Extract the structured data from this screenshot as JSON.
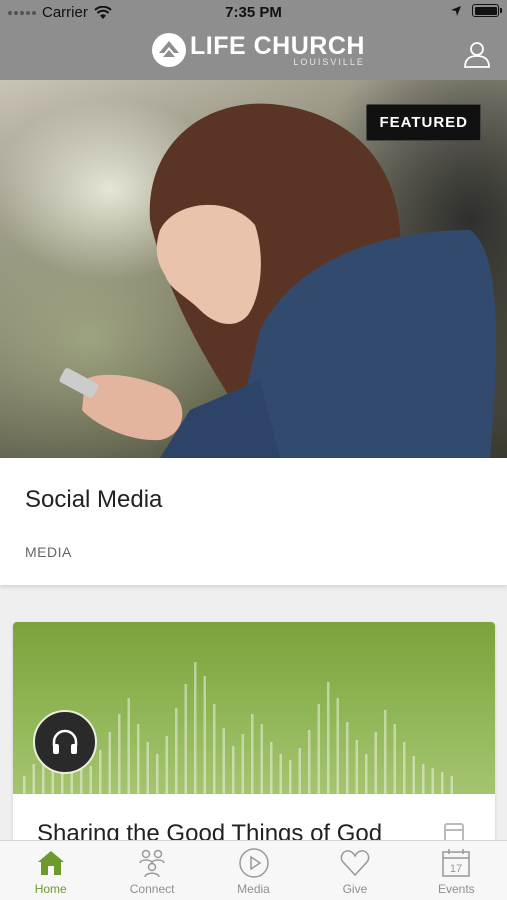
{
  "status_bar": {
    "carrier": "Carrier",
    "time": "7:35 PM"
  },
  "header": {
    "brand_name": "LIFE CHURCH",
    "brand_sub": "LOUISVILLE",
    "icons": [
      "church-logo-icon",
      "profile-icon"
    ]
  },
  "hero": {
    "badge": "FEATURED"
  },
  "featured_card": {
    "title": "Social Media",
    "category": "MEDIA"
  },
  "media_card": {
    "title": "Sharing the Good Things of God",
    "icons": [
      "headphones-icon",
      "document-icon"
    ]
  },
  "tabs": [
    {
      "label": "Home",
      "icon": "home-icon",
      "active": true
    },
    {
      "label": "Connect",
      "icon": "connect-icon",
      "active": false
    },
    {
      "label": "Media",
      "icon": "play-icon",
      "active": false
    },
    {
      "label": "Give",
      "icon": "heart-icon",
      "active": false
    },
    {
      "label": "Events",
      "icon": "calendar-icon",
      "active": false,
      "date": "17"
    }
  ],
  "colors": {
    "header_bg": "#8e8e8e",
    "accent": "#6e9a2c",
    "media_green": "#7ba23b"
  }
}
